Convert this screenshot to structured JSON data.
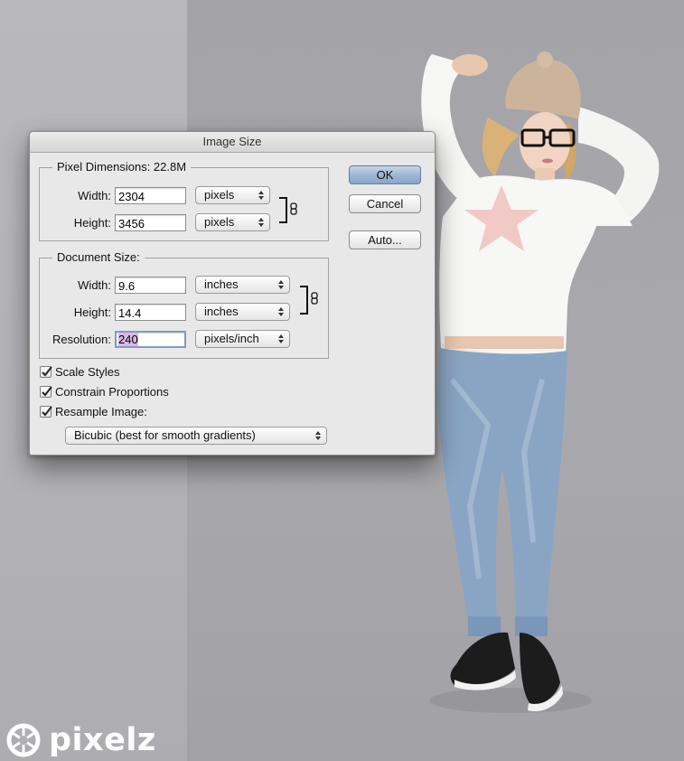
{
  "dialog": {
    "title": "Image Size",
    "pixel_dimensions": {
      "legend": "Pixel Dimensions:  22.8M",
      "width_label": "Width:",
      "width_value": "2304",
      "width_unit": "pixels",
      "height_label": "Height:",
      "height_value": "3456",
      "height_unit": "pixels"
    },
    "document_size": {
      "legend": "Document Size:",
      "width_label": "Width:",
      "width_value": "9.6",
      "width_unit": "inches",
      "height_label": "Height:",
      "height_value": "14.4",
      "height_unit": "inches",
      "resolution_label": "Resolution:",
      "resolution_value": "240",
      "resolution_unit": "pixels/inch"
    },
    "buttons": {
      "ok": "OK",
      "cancel": "Cancel",
      "auto": "Auto..."
    },
    "checkboxes": [
      {
        "label": "Scale Styles",
        "checked": true
      },
      {
        "label": "Constrain Proportions",
        "checked": true
      },
      {
        "label": "Resample Image:",
        "checked": true
      }
    ],
    "resample_method": "Bicubic (best for smooth gradients)",
    "accent_color": "#9fb6d4",
    "selection_color": "#d9b8e6"
  },
  "watermark": {
    "text": "pixelz",
    "icon": "aperture-icon"
  }
}
